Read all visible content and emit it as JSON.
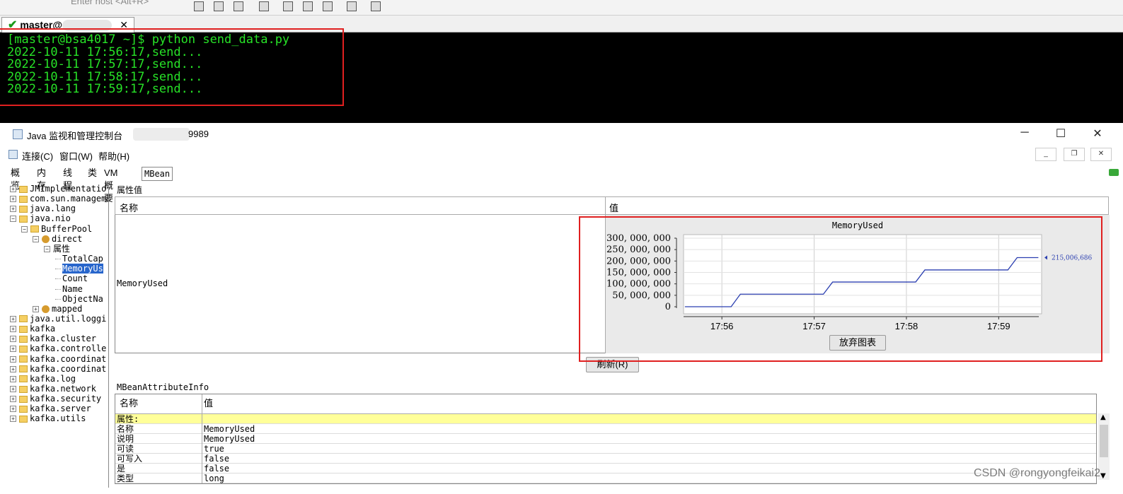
{
  "terminal": {
    "placeholder_hint": "Enter host <Alt+R>",
    "tab_title": "master@",
    "lines": [
      "[master@bsa4017 ~]$ python send_data.py",
      "2022-10-11 17:56:17,send...",
      "2022-10-11 17:57:17,send...",
      "2022-10-11 17:58:17,send...",
      "2022-10-11 17:59:17,send..."
    ]
  },
  "window": {
    "title": "Java 监视和管理控制台",
    "port_suffix": "9989"
  },
  "menu": [
    "连接(C)",
    "窗口(W)",
    "帮助(H)"
  ],
  "tabs": [
    "概览",
    "内存",
    "线程",
    "类",
    "VM 概要",
    "MBean"
  ],
  "tree": [
    {
      "label": "JMImplementatio",
      "depth": 0,
      "type": "folder",
      "exp": "+"
    },
    {
      "label": "com.sun.managem",
      "depth": 0,
      "type": "folder",
      "exp": "+"
    },
    {
      "label": "java.lang",
      "depth": 0,
      "type": "folder",
      "exp": "+"
    },
    {
      "label": "java.nio",
      "depth": 0,
      "type": "folder",
      "exp": "-"
    },
    {
      "label": "BufferPool",
      "depth": 1,
      "type": "folder",
      "exp": "-"
    },
    {
      "label": "direct",
      "depth": 2,
      "type": "bean",
      "exp": "-"
    },
    {
      "label": "属性",
      "depth": 3,
      "type": "none",
      "exp": "-"
    },
    {
      "label": "TotalCap",
      "depth": 4,
      "type": "leaf"
    },
    {
      "label": "MemoryUs",
      "depth": 4,
      "type": "leaf",
      "selected": true
    },
    {
      "label": "Count",
      "depth": 4,
      "type": "leaf"
    },
    {
      "label": "Name",
      "depth": 4,
      "type": "leaf"
    },
    {
      "label": "ObjectNa",
      "depth": 4,
      "type": "leaf"
    },
    {
      "label": "mapped",
      "depth": 2,
      "type": "bean",
      "exp": "+"
    },
    {
      "label": "java.util.loggi",
      "depth": 0,
      "type": "folder",
      "exp": "+"
    },
    {
      "label": "kafka",
      "depth": 0,
      "type": "folder",
      "exp": "+"
    },
    {
      "label": "kafka.cluster",
      "depth": 0,
      "type": "folder",
      "exp": "+"
    },
    {
      "label": "kafka.controlle",
      "depth": 0,
      "type": "folder",
      "exp": "+"
    },
    {
      "label": "kafka.coordinat",
      "depth": 0,
      "type": "folder",
      "exp": "+"
    },
    {
      "label": "kafka.coordinat",
      "depth": 0,
      "type": "folder",
      "exp": "+"
    },
    {
      "label": "kafka.log",
      "depth": 0,
      "type": "folder",
      "exp": "+"
    },
    {
      "label": "kafka.network",
      "depth": 0,
      "type": "folder",
      "exp": "+"
    },
    {
      "label": "kafka.security",
      "depth": 0,
      "type": "folder",
      "exp": "+"
    },
    {
      "label": "kafka.server",
      "depth": 0,
      "type": "folder",
      "exp": "+"
    },
    {
      "label": "kafka.utils",
      "depth": 0,
      "type": "folder",
      "exp": "+"
    }
  ],
  "attributes": {
    "section_title": "属性值",
    "col_name": "名称",
    "col_value": "值",
    "attr_name": "MemoryUsed",
    "discard_chart_button": "放弃图表",
    "refresh_button": "刷新(R)"
  },
  "chart_data": {
    "type": "line",
    "title": "MemoryUsed",
    "x_ticks": [
      "17:56",
      "17:57",
      "17:58",
      "17:59"
    ],
    "y_ticks": [
      "0",
      "50,000,000",
      "100,000,000",
      "150,000,000",
      "200,000,000",
      "250,000,000",
      "300,000,000"
    ],
    "ylim": [
      0,
      300000000
    ],
    "current_label": "215,006,686",
    "series": [
      {
        "color": "#2b3fb0",
        "x_minutes": [
          0,
          0.5,
          0.6,
          1.5,
          1.6,
          2.5,
          2.6,
          3.5,
          3.6,
          3.83
        ],
        "values": [
          0,
          0,
          55000000,
          55000000,
          108000000,
          108000000,
          161000000,
          161000000,
          215006686,
          215006686
        ]
      }
    ],
    "x_start_minute": "17:55:36",
    "grid": true
  },
  "info": {
    "section_title": "MBeanAttributeInfo",
    "col_name": "名称",
    "col_value": "值",
    "rows": [
      {
        "k": "属性:",
        "v": "",
        "highlight": true
      },
      {
        "k": "名称",
        "v": "MemoryUsed"
      },
      {
        "k": "说明",
        "v": "MemoryUsed"
      },
      {
        "k": "可读",
        "v": "true"
      },
      {
        "k": "可写入",
        "v": "false"
      },
      {
        "k": "是",
        "v": "false"
      },
      {
        "k": "类型",
        "v": "long"
      }
    ]
  },
  "watermark": "CSDN @rongyongfeikai2"
}
